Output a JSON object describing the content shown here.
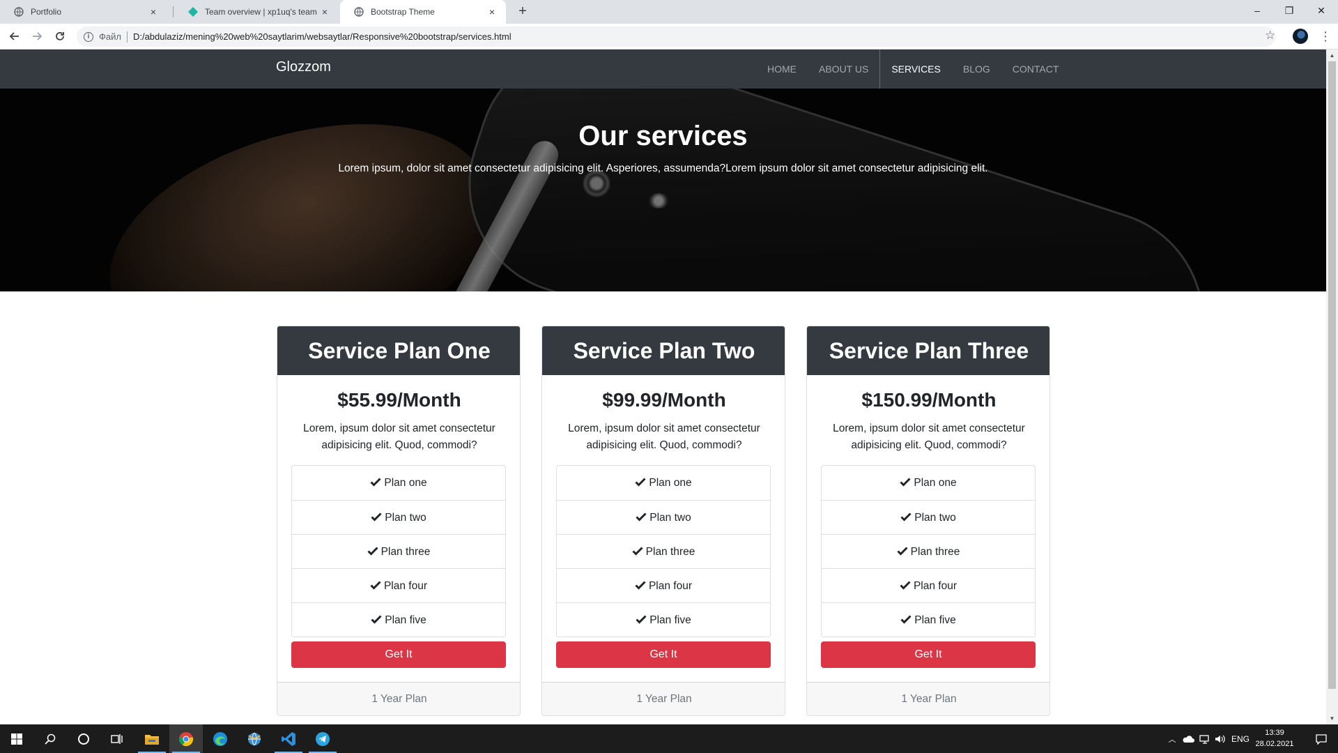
{
  "browser": {
    "tabs": [
      {
        "title": "Portfolio",
        "icon": "globe-icon",
        "active": false
      },
      {
        "title": "Team overview | xp1uq's team",
        "icon": "diamond-icon",
        "active": false
      },
      {
        "title": "Bootstrap Theme",
        "icon": "globe-icon",
        "active": true
      }
    ],
    "new_tab": "+",
    "close_glyph": "×",
    "window_controls": {
      "minimize": "–",
      "restore": "❐",
      "close": "✕"
    },
    "url_scheme": "Файл",
    "url": "D:/abdulaziz/mening%20web%20saytlarim/websaytlar/Responsive%20bootstrap/services.html"
  },
  "site": {
    "brand": "Glozzom",
    "nav": [
      {
        "label": "HOME",
        "active": false
      },
      {
        "label": "ABOUT US",
        "active": false
      },
      {
        "label": "SERVICES",
        "active": true
      },
      {
        "label": "BLOG",
        "active": false
      },
      {
        "label": "CONTACT",
        "active": false
      }
    ],
    "hero": {
      "title": "Our services",
      "text": "Lorem ipsum, dolor sit amet consectetur adipisicing elit. Asperiores, assumenda?Lorem ipsum dolor sit amet consectetur adipisicing elit."
    },
    "cards": [
      {
        "title": "Service Plan One",
        "price": "$55.99/Month",
        "desc": "Lorem, ipsum dolor sit amet consectetur adipisicing elit. Quod, commodi?",
        "features": [
          "Plan one",
          "Plan two",
          "Plan three",
          "Plan four",
          "Plan five"
        ],
        "button": "Get It",
        "footer": "1 Year Plan"
      },
      {
        "title": "Service Plan Two",
        "price": "$99.99/Month",
        "desc": "Lorem, ipsum dolor sit amet consectetur adipisicing elit. Quod, commodi?",
        "features": [
          "Plan one",
          "Plan two",
          "Plan three",
          "Plan four",
          "Plan five"
        ],
        "button": "Get It",
        "footer": "1 Year Plan"
      },
      {
        "title": "Service Plan Three",
        "price": "$150.99/Month",
        "desc": "Lorem, ipsum dolor sit amet consectetur adipisicing elit. Quod, commodi?",
        "features": [
          "Plan one",
          "Plan two",
          "Plan three",
          "Plan four",
          "Plan five"
        ],
        "button": "Get It",
        "footer": "1 Year Plan"
      }
    ]
  },
  "taskbar": {
    "language": "ENG",
    "time": "13:39",
    "date": "28.02.2021"
  },
  "colors": {
    "navbar": "#343a40",
    "button": "#dc3545",
    "card_footer": "#f7f7f7",
    "taskbar": "#1c1c1c"
  }
}
